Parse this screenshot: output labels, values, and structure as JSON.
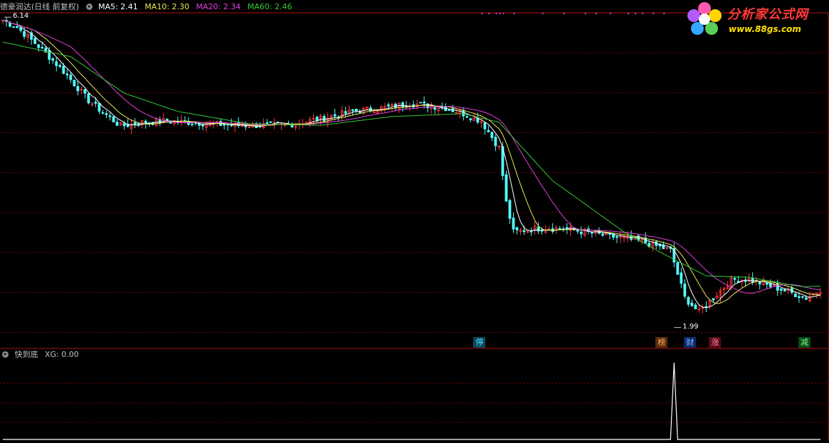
{
  "main_header": {
    "stock": "德豪润达(日线 前复权)",
    "indicators": [
      {
        "label": "MA5: 2.41",
        "color": "#ffffff"
      },
      {
        "label": "MA10: 2.30",
        "color": "#e8e85a"
      },
      {
        "label": "MA20: 2.34",
        "color": "#e040e0"
      },
      {
        "label": "MA60: 2.46",
        "color": "#34c834"
      }
    ]
  },
  "sub_header": {
    "name": "快到底",
    "value": "XG: 0.00"
  },
  "logo": {
    "title": "分析家公式网",
    "url": "www.88gs.com"
  },
  "colors": {
    "up": "#ff3a3a",
    "down": "#54ffff",
    "ma5": "#ffffff",
    "ma10": "#e8e85a",
    "ma20": "#e040e0",
    "ma60": "#34c834",
    "frame": "#b01010",
    "grid": "#800000"
  },
  "chart_data": [
    {
      "type": "candlestick",
      "name": "price",
      "x": {
        "first_bar": 1,
        "last_bar": 230
      },
      "ylim": [
        1.85,
        6.2
      ],
      "high_label": "6.14",
      "low_label": "1.99",
      "high_value": 6.14,
      "low_value": 1.99,
      "close_path": [
        [
          1,
          6.1
        ],
        [
          5,
          6.0
        ],
        [
          12,
          5.7
        ],
        [
          18,
          5.4
        ],
        [
          25,
          5.0
        ],
        [
          30,
          4.8
        ],
        [
          34,
          4.65
        ],
        [
          40,
          4.7
        ],
        [
          46,
          4.72
        ],
        [
          55,
          4.7
        ],
        [
          65,
          4.66
        ],
        [
          80,
          4.66
        ],
        [
          90,
          4.75
        ],
        [
          100,
          4.86
        ],
        [
          108,
          4.9
        ],
        [
          115,
          4.96
        ],
        [
          120,
          4.93
        ],
        [
          125,
          4.9
        ],
        [
          130,
          4.82
        ],
        [
          135,
          4.72
        ],
        [
          140,
          4.35
        ],
        [
          142,
          3.6
        ],
        [
          144,
          3.2
        ],
        [
          150,
          3.25
        ],
        [
          158,
          3.25
        ],
        [
          170,
          3.15
        ],
        [
          180,
          3.07
        ],
        [
          188,
          2.95
        ],
        [
          192,
          2.3
        ],
        [
          196,
          2.1
        ],
        [
          205,
          2.55
        ],
        [
          210,
          2.55
        ],
        [
          220,
          2.4
        ],
        [
          226,
          2.3
        ],
        [
          230,
          2.41
        ]
      ],
      "ma60_path": [
        [
          1,
          5.8
        ],
        [
          20,
          5.6
        ],
        [
          35,
          5.1
        ],
        [
          50,
          4.85
        ],
        [
          70,
          4.68
        ],
        [
          90,
          4.66
        ],
        [
          110,
          4.78
        ],
        [
          130,
          4.82
        ],
        [
          140,
          4.7
        ],
        [
          155,
          3.9
        ],
        [
          175,
          3.2
        ],
        [
          186,
          2.9
        ],
        [
          198,
          2.6
        ],
        [
          210,
          2.58
        ],
        [
          225,
          2.45
        ],
        [
          230,
          2.46
        ]
      ],
      "badges": [
        {
          "label": "停",
          "bar": 134,
          "bg": "#0a4a5a",
          "fg": "#5bd6ff"
        },
        {
          "label": "榜",
          "bar": 185,
          "bg": "#5a2a0a",
          "fg": "#ffb060"
        },
        {
          "label": "财",
          "bar": 193,
          "bg": "#0a2a6a",
          "fg": "#8ab8ff"
        },
        {
          "label": "涨",
          "bar": 200,
          "bg": "#5a0a1a",
          "fg": "#ff8aa0"
        },
        {
          "label": "减",
          "bar": 225,
          "bg": "#0a4a1a",
          "fg": "#7aff7a"
        }
      ],
      "dots": {
        "color": "#d040d0",
        "bars": [
          135,
          137,
          139,
          140,
          141,
          144,
          152,
          158,
          164,
          167,
          171,
          176,
          178,
          180,
          183,
          186
        ]
      }
    },
    {
      "type": "line",
      "name": "XG",
      "series": [
        {
          "name": "XG",
          "values_nonzero": [
            {
              "bar": 189,
              "value": 1
            }
          ]
        }
      ],
      "ylim": [
        0,
        1
      ],
      "color": "#ffffff"
    }
  ]
}
